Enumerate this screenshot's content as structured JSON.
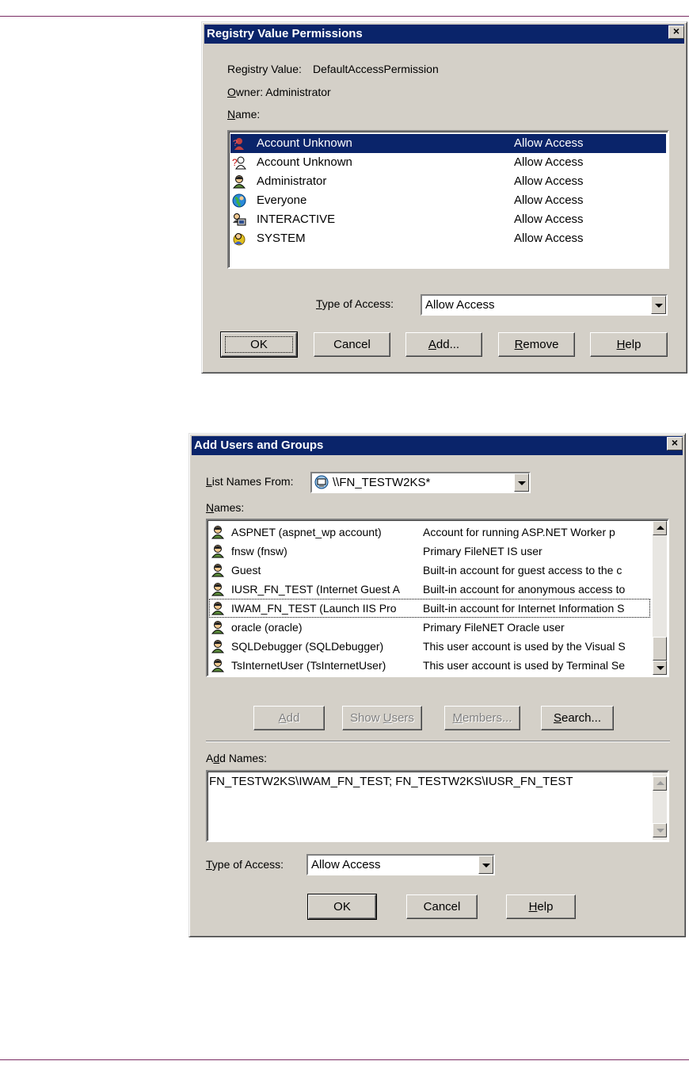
{
  "dialog1": {
    "title": "Registry Value Permissions",
    "close": "×",
    "registry_value_label": "Registry Value:",
    "registry_value": "DefaultAccessPermission",
    "owner_label_ul": "O",
    "owner_label_rest": "wner:",
    "owner": "Administrator",
    "name_label_ul": "N",
    "name_label_rest": "ame:",
    "entries": [
      {
        "name": "Account Unknown",
        "access": "Allow Access",
        "icon": "unknown-user-icon",
        "selected": true
      },
      {
        "name": "Account Unknown",
        "access": "Allow Access",
        "icon": "unknown-user-icon"
      },
      {
        "name": "Administrator",
        "access": "Allow Access",
        "icon": "user-icon"
      },
      {
        "name": "Everyone",
        "access": "Allow Access",
        "icon": "globe-group-icon"
      },
      {
        "name": "INTERACTIVE",
        "access": "Allow Access",
        "icon": "interactive-group-icon"
      },
      {
        "name": "SYSTEM",
        "access": "Allow Access",
        "icon": "system-group-icon"
      }
    ],
    "type_label_ul": "T",
    "type_label_rest": "ype of Access:",
    "type_value": "Allow Access",
    "buttons": {
      "ok": "OK",
      "cancel": "Cancel",
      "add_ul": "A",
      "add_rest": "dd...",
      "remove_ul": "R",
      "remove_rest": "emove",
      "help_ul": "H",
      "help_rest": "elp"
    }
  },
  "dialog2": {
    "title": "Add Users and Groups",
    "close": "×",
    "list_from_label_ul": "L",
    "list_from_label_rest": "ist Names From:",
    "list_from_value": "\\\\FN_TESTW2KS*",
    "names_label_ul": "N",
    "names_label_rest": "ames:",
    "names": [
      {
        "name": "ASPNET (aspnet_wp account)",
        "desc": "Account for running ASP.NET Worker p"
      },
      {
        "name": "fnsw (fnsw)",
        "desc": "Primary FileNET IS user"
      },
      {
        "name": "Guest",
        "desc": "Built-in account for guest access to the c"
      },
      {
        "name": "IUSR_FN_TEST (Internet Guest A",
        "desc": "Built-in account for anonymous access to"
      },
      {
        "name": "IWAM_FN_TEST (Launch IIS Pro",
        "desc": "Built-in account for Internet Information S",
        "focused": true
      },
      {
        "name": "oracle (oracle)",
        "desc": "Primary FileNET Oracle user"
      },
      {
        "name": "SQLDebugger (SQLDebugger)",
        "desc": "This user account is used by the Visual S"
      },
      {
        "name": "TsInternetUser (TsInternetUser)",
        "desc": "This user account is used by Terminal Se"
      }
    ],
    "buttons": {
      "add_ul": "A",
      "add_rest": "dd",
      "show_users_pre": "Show ",
      "show_users_ul": "U",
      "show_users_rest": "sers",
      "members_ul": "M",
      "members_rest": "embers...",
      "search_ul": "S",
      "search_rest": "earch...",
      "ok": "OK",
      "cancel": "Cancel",
      "help_ul": "H",
      "help_rest": "elp"
    },
    "add_names_label_pre": "A",
    "add_names_label_ul": "d",
    "add_names_label_rest": "d Names:",
    "add_names_value": "FN_TESTW2KS\\IWAM_FN_TEST; FN_TESTW2KS\\IUSR_FN_TEST",
    "type_label_ul": "T",
    "type_label_rest": "ype of Access:",
    "type_value": "Allow Access"
  }
}
